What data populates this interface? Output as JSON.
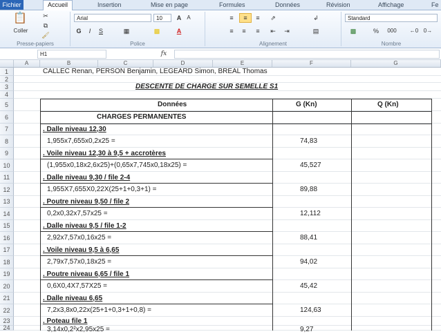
{
  "tabs": [
    "Fichier",
    "Accueil",
    "Insertion",
    "Mise en page",
    "Formules",
    "Données",
    "Révision",
    "Affichage",
    "Fe"
  ],
  "ribbon": {
    "paste_label": "Coller",
    "font_name": "Arial",
    "font_size": "10",
    "number_format": "Standard",
    "percent": "%",
    "thousands": "000",
    "groups": [
      "Presse-papiers",
      "Police",
      "Alignement",
      "Nombre"
    ]
  },
  "formula_bar": {
    "cell_ref": "H1",
    "fx": "fx",
    "formula": ""
  },
  "columns": [
    "A",
    "B",
    "C",
    "D",
    "E",
    "F",
    "G"
  ],
  "rows": [
    {
      "n": "1",
      "b": "CALLEC Renan, PERSON Benjamin, LEGEARD Simon, BREAL Thomas",
      "f": ""
    },
    {
      "n": "2",
      "b": "",
      "f": ""
    },
    {
      "n": "3",
      "b": "DESCENTE DE CHARGE SUR SEMELLE  S1",
      "f": ""
    },
    {
      "n": "4",
      "b": "",
      "f": ""
    },
    {
      "n": "5",
      "b": "Données",
      "f": "G (Kn)",
      "g": "Q (Kn)"
    },
    {
      "n": "6",
      "b": "CHARGES PERMANENTES",
      "f": ""
    },
    {
      "n": "7",
      "b": ". Dalle niveau 12,30",
      "f": ""
    },
    {
      "n": "8",
      "b": "1,955x7,655x0,2x25 =",
      "f": "74,83"
    },
    {
      "n": "9",
      "b": ". Voile niveau 12,30 à 9,5 + accrotères",
      "f": ""
    },
    {
      "n": "10",
      "b": "(1,955x0,18x2,6x25)+(0,65x7,745x0,18x25) =",
      "f": "45,527"
    },
    {
      "n": "11",
      "b": ". Dalle niveau 9,30 / file 2-4",
      "f": ""
    },
    {
      "n": "12",
      "b": "1,955X7,655X0,22X(25+1+0,3+1) =",
      "f": "89,88"
    },
    {
      "n": "13",
      "b": ". Poutre niveau 9,50 / file 2",
      "f": ""
    },
    {
      "n": "14",
      "b": "0,2x0,32x7,57x25 =",
      "f": "12,112"
    },
    {
      "n": "15",
      "b": ". Dalle niveau 9,5 / file 1-2",
      "f": ""
    },
    {
      "n": "16",
      "b": "2,92x7,57x0,16x25 =",
      "f": "88,41"
    },
    {
      "n": "17",
      "b": ". Voile niveau 9,5 à 6,65",
      "f": ""
    },
    {
      "n": "18",
      "b": "2,79x7,57x0,18x25 =",
      "f": "94,02"
    },
    {
      "n": "19",
      "b": ". Poutre niveau 6,65 / file 1",
      "f": ""
    },
    {
      "n": "20",
      "b": "0,6X0,4X7,57X25 =",
      "f": "45,42"
    },
    {
      "n": "21",
      "b": ". Dalle niveau 6,65",
      "f": ""
    },
    {
      "n": "22",
      "b": "7,2x3,8x0,22x(25+1+0,3+1+0,8) =",
      "f": "124,63"
    },
    {
      "n": "23",
      "b": ". Poteau file 1",
      "f": ""
    },
    {
      "n": "24",
      "b": "3,14x0,2²x2,95x25 =",
      "f": "9,27"
    }
  ]
}
